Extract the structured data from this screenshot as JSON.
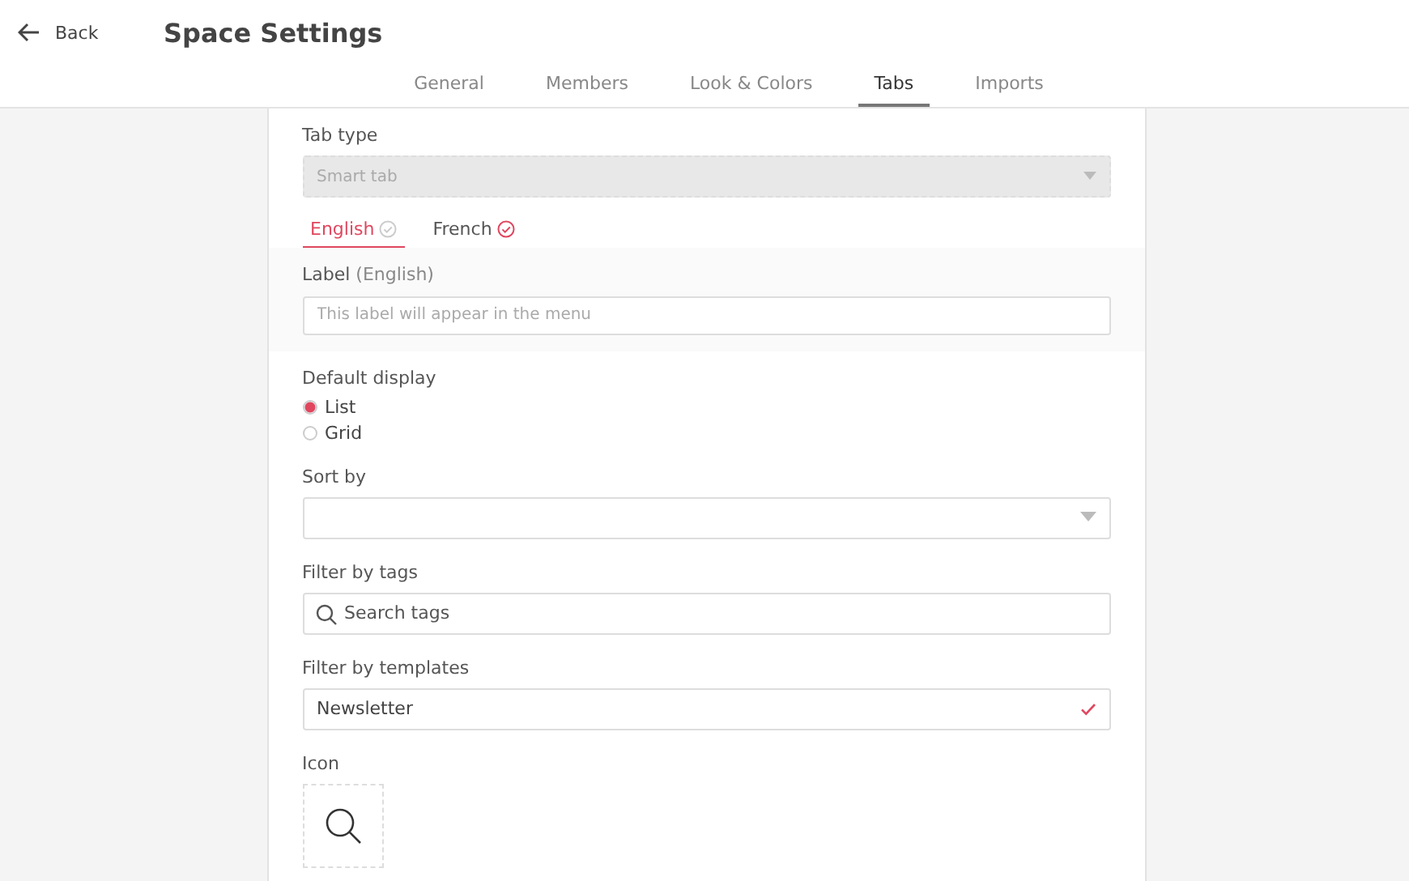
{
  "header": {
    "back": "Back",
    "title": "Space Settings"
  },
  "tabs": [
    {
      "label": "General",
      "selected": false
    },
    {
      "label": "Members",
      "selected": false
    },
    {
      "label": "Look & Colors",
      "selected": false
    },
    {
      "label": "Tabs",
      "selected": true
    },
    {
      "label": "Imports",
      "selected": false
    }
  ],
  "tab_type": {
    "label": "Tab type",
    "value": "Smart tab",
    "disabled": true
  },
  "languages": [
    {
      "label": "English",
      "selected": true,
      "complete": false
    },
    {
      "label": "French",
      "selected": false,
      "complete": true
    }
  ],
  "label_field": {
    "label": "Label",
    "hint": "(English)",
    "placeholder": "This label will appear in the menu"
  },
  "default_display": {
    "label": "Default display",
    "options": [
      {
        "label": "List",
        "selected": true
      },
      {
        "label": "Grid",
        "selected": false
      }
    ]
  },
  "sort_by": {
    "label": "Sort by"
  },
  "filter_tags": {
    "label": "Filter by tags",
    "placeholder": "Search tags"
  },
  "filter_templates": {
    "label": "Filter by templates",
    "value": "Newsletter"
  },
  "icon": {
    "label": "Icon"
  }
}
